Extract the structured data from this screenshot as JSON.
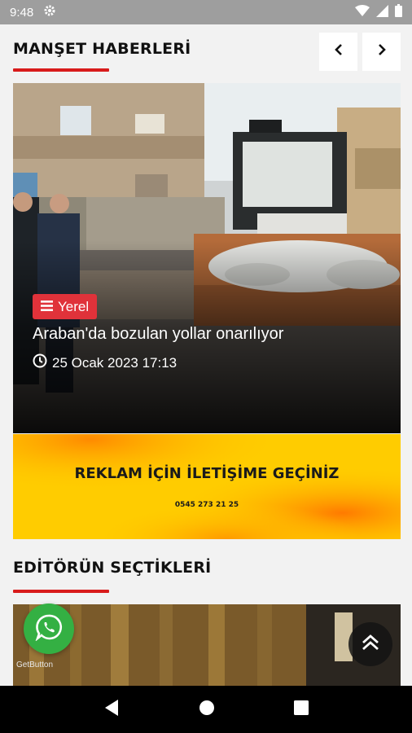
{
  "status_bar": {
    "time": "9:48",
    "icons": [
      "gear-icon",
      "wifi-icon",
      "signal-icon",
      "battery-icon"
    ]
  },
  "headline_section": {
    "title": "MANŞET HABERLERİ",
    "prev_icon": "chevron-left-icon",
    "next_icon": "chevron-right-icon"
  },
  "hero": {
    "category": "Yerel",
    "category_icon": "menu-icon",
    "title": "Araban'da bozulan yollar onarılıyor",
    "date": "25 Ocak 2023 17:13",
    "date_icon": "clock-icon"
  },
  "ad": {
    "title": "REKLAM İÇİN İLETİŞİME GEÇİNİZ",
    "phone": "0545 273 21 25"
  },
  "editor_section": {
    "title": "EDİTÖRÜN SEÇTİKLERİ"
  },
  "floating": {
    "getbutton_label": "GetButton",
    "whatsapp_icon": "whatsapp-icon",
    "scroll_icon": "double-chevron-up-icon"
  },
  "colors": {
    "accent": "#d81b1b",
    "badge": "#e0323a",
    "whatsapp": "#34b043",
    "ad_yellow": "#ffcc00"
  }
}
